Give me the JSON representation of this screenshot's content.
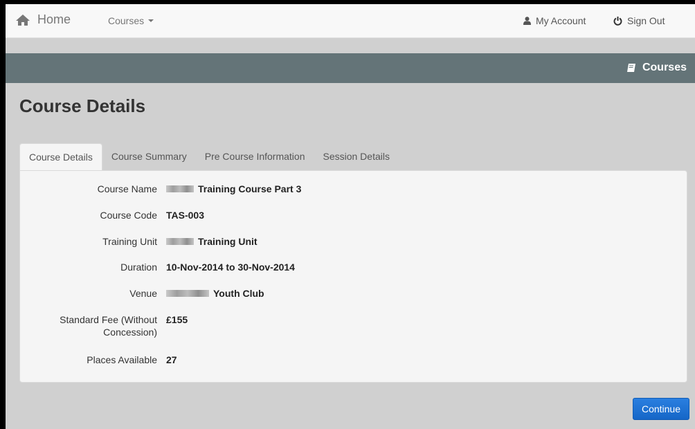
{
  "navbar": {
    "home_label": "Home",
    "courses_label": "Courses",
    "my_account_label": "My Account",
    "sign_out_label": "Sign Out"
  },
  "band": {
    "title": "Courses"
  },
  "page": {
    "title": "Course Details"
  },
  "tabs": [
    {
      "label": "Course Details",
      "active": true
    },
    {
      "label": "Course Summary",
      "active": false
    },
    {
      "label": "Pre Course Information",
      "active": false
    },
    {
      "label": "Session Details",
      "active": false
    }
  ],
  "details": {
    "course_name": {
      "label": "Course Name",
      "value": "Training Course Part 3"
    },
    "course_code": {
      "label": "Course Code",
      "value": "TAS-003"
    },
    "training_unit": {
      "label": "Training Unit",
      "value": "Training Unit"
    },
    "duration": {
      "label": "Duration",
      "value": "10-Nov-2014 to 30-Nov-2014"
    },
    "venue": {
      "label": "Venue",
      "value": "Youth Club"
    },
    "standard_fee": {
      "label_line1": "Standard Fee (Without",
      "label_line2": "Concession)",
      "value": "£155"
    },
    "places_available": {
      "label": "Places Available",
      "value": "27"
    }
  },
  "actions": {
    "continue_label": "Continue"
  },
  "colors": {
    "band": "#647478",
    "primary": "#1a6fd0"
  }
}
